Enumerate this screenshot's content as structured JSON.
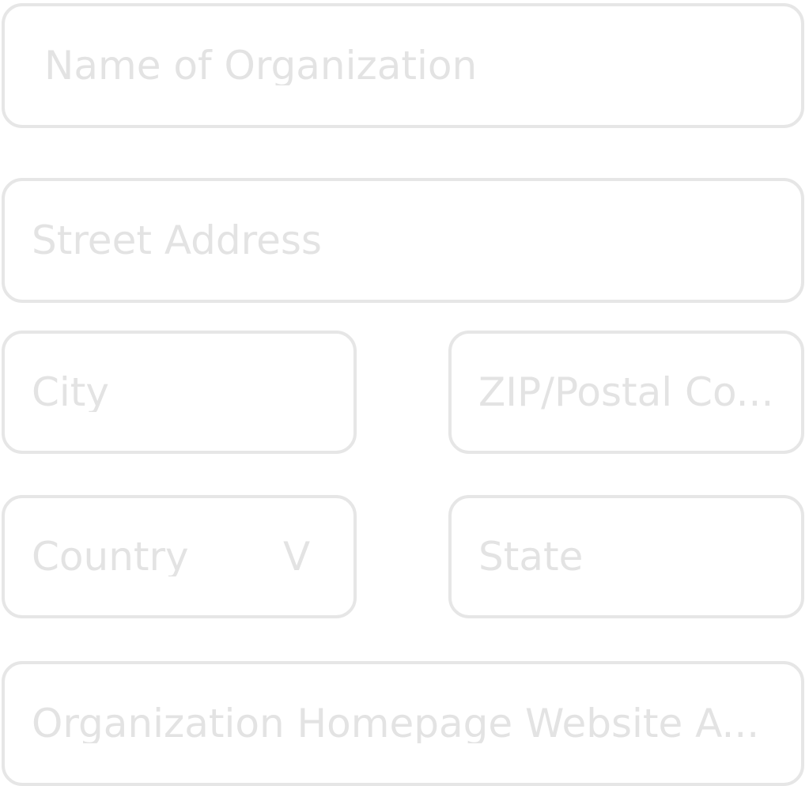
{
  "form": {
    "organization_name": {
      "placeholder": "Name of Organization"
    },
    "street_address": {
      "placeholder": "Street Address"
    },
    "city": {
      "placeholder": "City"
    },
    "zip": {
      "placeholder": "ZIP/Postal Co..."
    },
    "country": {
      "placeholder": "Country",
      "chevron": "V",
      "icon": "chevron-down-icon"
    },
    "state": {
      "placeholder": "State"
    },
    "website": {
      "placeholder": "Organization Homepage Website A..."
    }
  },
  "colors": {
    "border": "#e6e6e6",
    "placeholder": "#e3e3e3",
    "background": "#ffffff"
  }
}
